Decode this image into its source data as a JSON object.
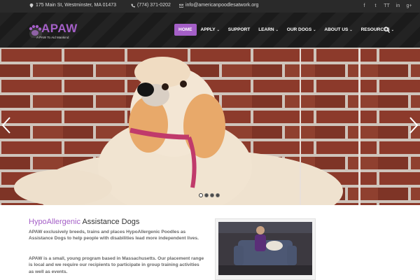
{
  "topbar": {
    "address": "175 Main St, Westminster, MA 01473",
    "phone": "(774) 371-0202",
    "email": "info@americanpoodlesatwork.org",
    "socials": [
      {
        "icon": "facebook-icon",
        "glyph": "f"
      },
      {
        "icon": "twitter-icon",
        "glyph": "t"
      },
      {
        "icon": "tripadvisor-icon",
        "glyph": "TT"
      },
      {
        "icon": "linkedin-icon",
        "glyph": "in"
      },
      {
        "icon": "google-plus-icon",
        "glyph": "g+"
      }
    ]
  },
  "brand": {
    "name": "APAW",
    "tagline": "A PAW To Aid Mankind",
    "accent": "#a45fc7"
  },
  "nav": {
    "items": [
      {
        "label": "HOME",
        "active": true,
        "dropdown": false
      },
      {
        "label": "APPLY",
        "active": false,
        "dropdown": true
      },
      {
        "label": "SUPPORT",
        "active": false,
        "dropdown": false
      },
      {
        "label": "LEARN",
        "active": false,
        "dropdown": true
      },
      {
        "label": "OUR DOGS",
        "active": false,
        "dropdown": true
      },
      {
        "label": "ABOUT US",
        "active": false,
        "dropdown": true
      },
      {
        "label": "RESOURCES",
        "active": false,
        "dropdown": true
      }
    ]
  },
  "slider": {
    "dots": 4,
    "active_dot": 1
  },
  "content": {
    "title_accent": "HypoAllergenic",
    "title_rest": "Assistance Dogs",
    "para1": "APAW exclusively breeds, trains and places HypoAllergenic Poodles as Assistance Dogs to help people with disabilities lead more independent lives.",
    "para2": "APAW is a small, young program based in Massachusetts. Our placement range is local and we require our recipients to participate in group training activities as well as events."
  }
}
